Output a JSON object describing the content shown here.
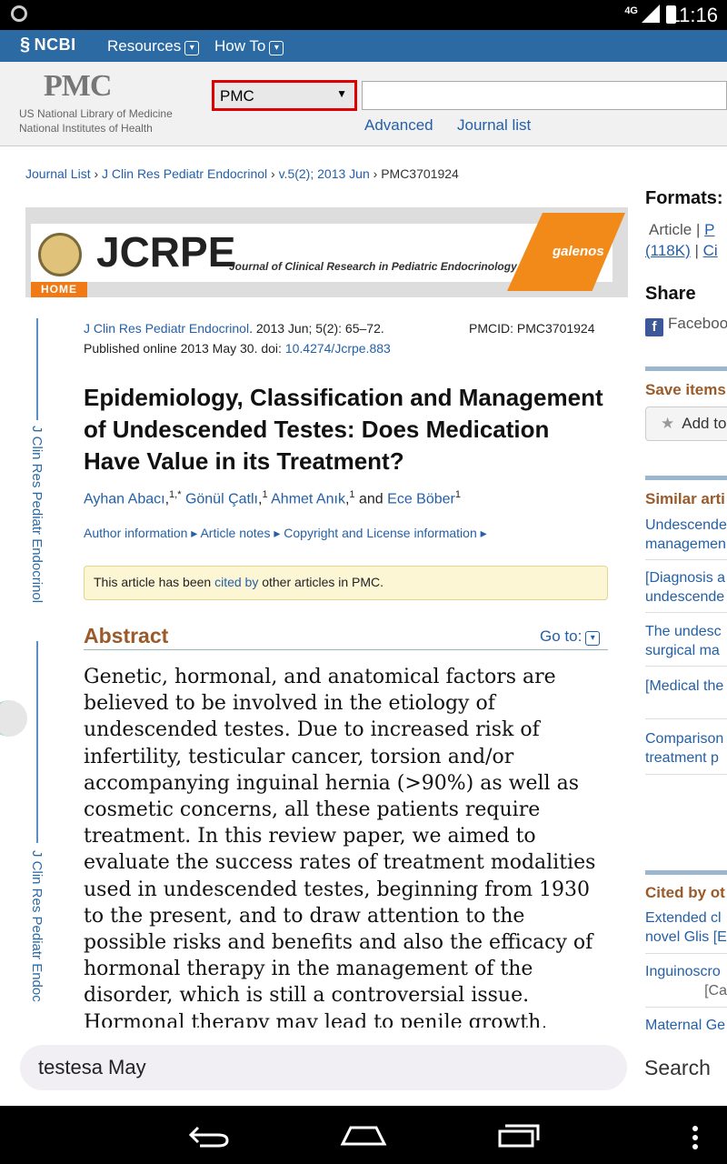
{
  "status_bar": {
    "network": "4G",
    "time": "11:16"
  },
  "ncbi_bar": {
    "logo": "NCBI",
    "resources_label": "Resources",
    "howto_label": "How To"
  },
  "header": {
    "pmc_logo": "PMC",
    "library_line1": "US National Library of Medicine",
    "library_line2": "National Institutes of Health",
    "db_select_value": "PMC",
    "search_value": "",
    "advanced_label": "Advanced",
    "journal_list_label": "Journal list"
  },
  "breadcrumb": {
    "items": [
      "Journal List",
      "J Clin Res Pediatr Endocrinol",
      "v.5(2); 2013 Jun",
      "PMC3701924"
    ]
  },
  "banner": {
    "logo_text": "JCRPE",
    "subtitle": "Journal of Clinical Research in Pediatric Endocrinology",
    "publisher": "galenos",
    "home_label": "HOME"
  },
  "side_tab": {
    "label_top": "J Clin Res Pediatr Endocrinol",
    "label_bottom": "J Clin Res Pediatr Endoc"
  },
  "citation": {
    "journal": "J Clin Res Pediatr Endocrinol",
    "details": ". 2013 Jun; 5(2): 65–72.",
    "published": "Published online 2013 May 30. doi: ",
    "doi": "10.4274/Jcrpe.883",
    "pmcid": "PMCID: PMC3701924"
  },
  "article": {
    "title": "Epidemiology, Classification and Management of Undescended Testes: Does Medication Have Value in its Treatment?",
    "authors": [
      {
        "name": "Ayhan Abacı",
        "sup": "1,*"
      },
      {
        "name": "Gönül Çatlı",
        "sup": "1"
      },
      {
        "name": "Ahmet Anık",
        "sup": "1"
      },
      {
        "name": "Ece Böber",
        "sup": "1"
      }
    ],
    "and_label": "and",
    "info_links": [
      "Author information ▸",
      "Article notes ▸",
      "Copyright and License information ▸"
    ],
    "cited_prefix": "This article has been ",
    "cited_link": "cited by",
    "cited_suffix": " other articles in PMC.",
    "abstract_heading": "Abstract",
    "goto_label": "Go to:",
    "abstract_text": "Genetic, hormonal, and anatomical factors are believed to be involved in the etiology of undescended testes. Due to increased risk of infertility, testicular cancer, torsion and/or accompanying inguinal hernia (>90%) as well as cosmetic concerns, all these patients require treatment. In this review paper, we aimed to evaluate the success rates of treatment modalities used in undescended testes, beginning from 1930 to the present, and to draw attention to the possible risks and benefits and also the efficacy of hormonal therapy in the management of the disorder, which is still a controversial issue. Hormonal therapy may lead to penile growth, painful erection, and behavioral changes while on treatment. In recent years, it has been reported that human chorionic gonadotropin"
  },
  "sidebar": {
    "formats_heading": "Formats:",
    "formats_line1_a": "Article",
    "formats_line1_b": "P",
    "formats_line2_a": "(118K)",
    "formats_line2_b": "Ci",
    "share_heading": "Share",
    "facebook_label": "Faceboo",
    "save_heading": "Save items",
    "add_label": "Add to",
    "similar_heading": "Similar arti",
    "similar_items": [
      [
        "Undescende",
        "managemen"
      ],
      [
        "[Diagnosis a",
        "undescende"
      ],
      [
        "The undesc",
        "surgical ma"
      ],
      [
        "[Medical the"
      ],
      [
        "Comparison",
        "treatment p"
      ]
    ],
    "cited_heading": "Cited by ot",
    "cited_items": [
      [
        "Extended cl",
        "novel Glis [E"
      ],
      [
        "Inguinoscro",
        "[Ca"
      ],
      [
        "Maternal Ge"
      ]
    ]
  },
  "find_bar": {
    "query": "testesa May",
    "search_label": "Search"
  }
}
